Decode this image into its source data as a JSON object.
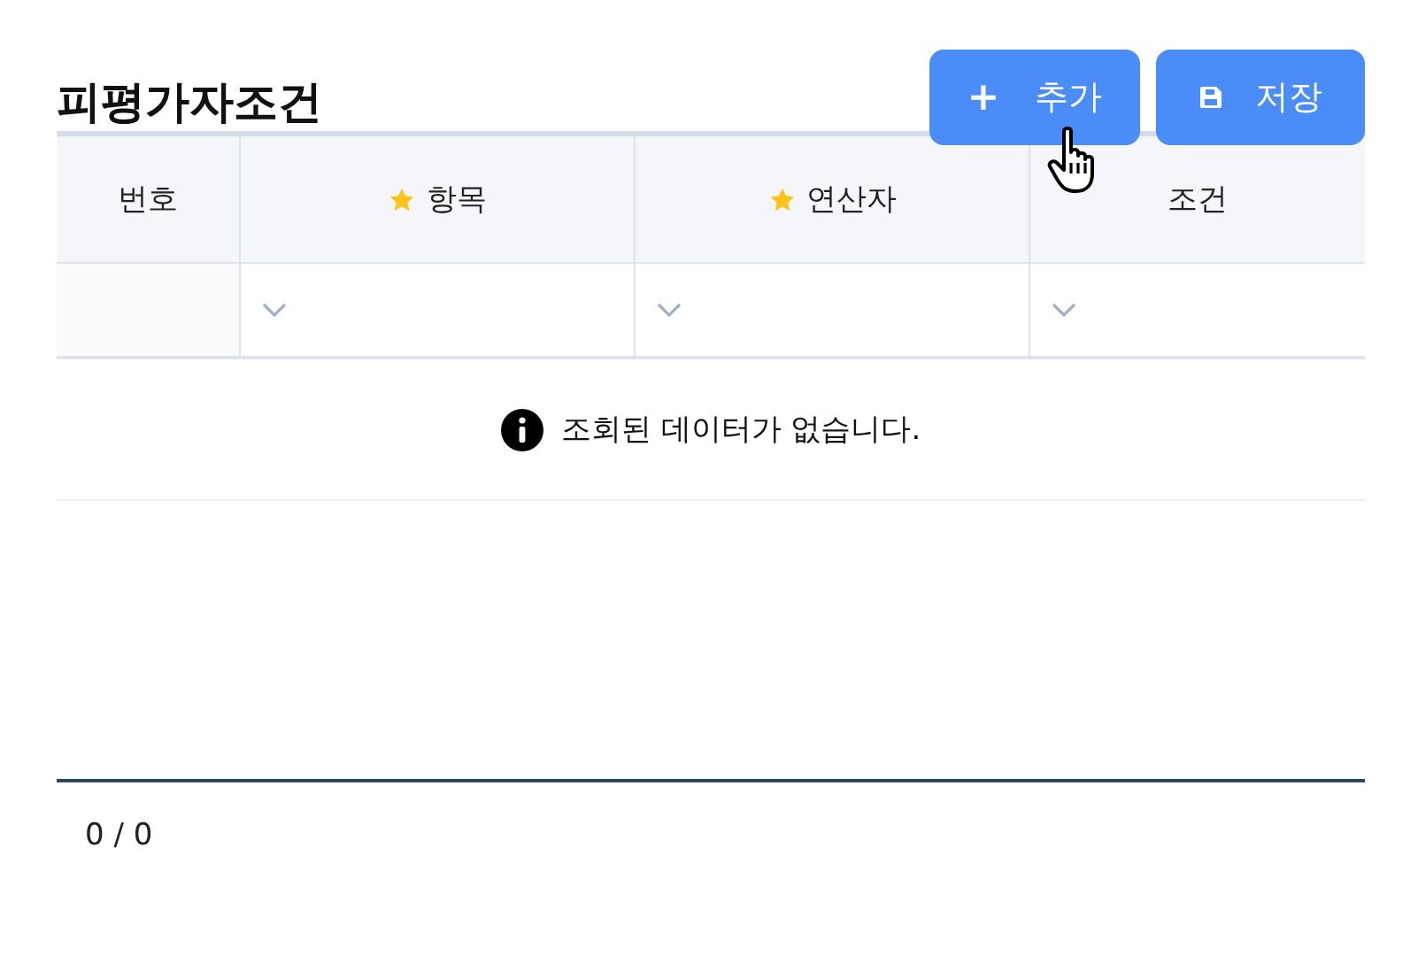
{
  "title": "피평가자조건",
  "buttons": [
    {
      "kind": "add",
      "icon": "+",
      "label": "추가"
    },
    {
      "kind": "save",
      "label": "저장"
    }
  ],
  "table": {
    "columns": [
      {
        "label": "번호",
        "required": false
      },
      {
        "label": "항목",
        "required": true
      },
      {
        "label": "연산자",
        "required": true
      },
      {
        "label": "조건",
        "required": false
      }
    ],
    "filters": [
      {
        "kind": "blank"
      },
      {
        "kind": "select"
      },
      {
        "kind": "select"
      },
      {
        "kind": "select"
      }
    ],
    "empty_message": "조회된 데이터가 없습니다."
  },
  "pager": {
    "count": "0 / 0"
  }
}
